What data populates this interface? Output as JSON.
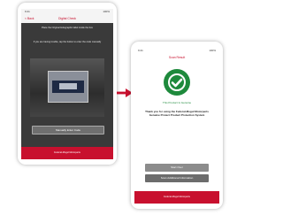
{
  "colors": {
    "brand_red": "#c8102e",
    "success_green": "#1e8a3c",
    "button_gray": "#8c8c8c"
  },
  "left_screen": {
    "status_left": "9:41",
    "status_right": "100%",
    "nav": {
      "back_label": "< Back",
      "title": "Digital Check"
    },
    "instructions": [
      "Place the Original Holographic label inside the box",
      "If you are having trouble, tap the button to enter the code manually"
    ],
    "manual_button": "Manually Enter Code",
    "footer": "Federal-Mogul Motorparts"
  },
  "right_screen": {
    "status_left": "9:41",
    "status_right": "100%",
    "nav": {
      "title": "Scan Result"
    },
    "result_text": "This Product Is Genuine",
    "thanks_text": "Thank you for using the Federal-Mogul Motorparts Genuine Protect Product Protection System",
    "buttons": {
      "start_over": "Start Over",
      "more_info": "Scan Additional Information"
    },
    "footer": "Federal-Mogul Motorparts"
  },
  "icons": {
    "arrow": "right-arrow-icon",
    "check": "check-circle-icon"
  }
}
